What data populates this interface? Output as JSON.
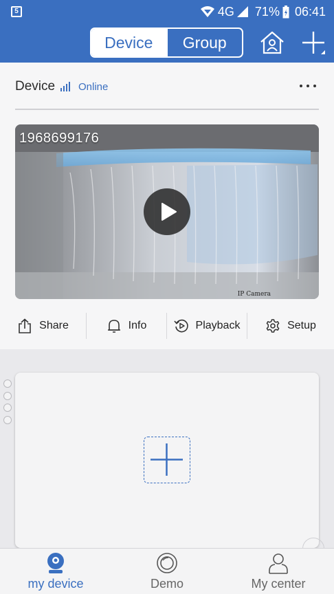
{
  "status_bar": {
    "network": "4G",
    "battery": "71%",
    "time": "06:41"
  },
  "header": {
    "tabs": [
      {
        "label": "Device",
        "active": true
      },
      {
        "label": "Group",
        "active": false
      }
    ]
  },
  "device": {
    "title": "Device",
    "status": "Online",
    "camera_id": "1968699176",
    "watermark": "IP Camera",
    "actions": [
      {
        "label": "Share"
      },
      {
        "label": "Info"
      },
      {
        "label": "Playback"
      },
      {
        "label": "Setup"
      }
    ]
  },
  "nav": [
    {
      "label": "my device",
      "icon": "camera-icon",
      "active": true
    },
    {
      "label": "Demo",
      "icon": "lens-icon",
      "active": false
    },
    {
      "label": "My center",
      "icon": "person-icon",
      "active": false
    }
  ],
  "colors": {
    "primary": "#3a6fc0",
    "background": "#e9e9ec"
  }
}
